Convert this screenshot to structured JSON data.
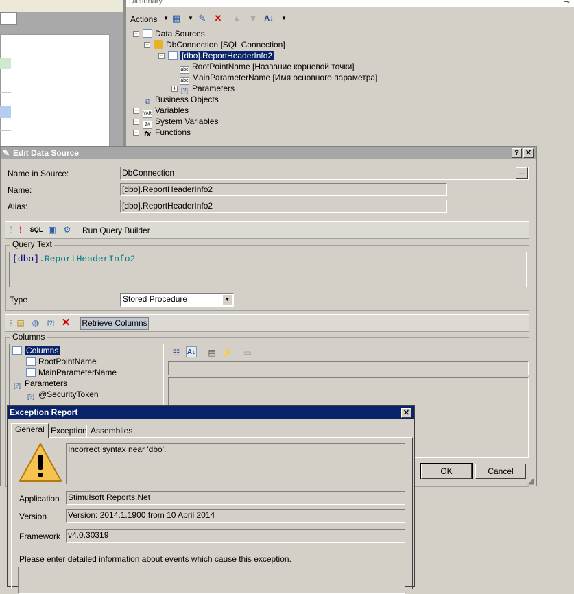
{
  "dictionary": {
    "title": "Dictionary",
    "toolbar": {
      "actions_label": "Actions"
    },
    "tree": {
      "data_sources": "Data Sources",
      "connection": "DbConnection [SQL Connection]",
      "table": "[dbo].ReportHeaderInfo2",
      "col1": "RootPointName [Название корневой точки]",
      "col2": "MainParameterName [Имя основного параметра]",
      "parameters": "Parameters",
      "business_objects": "Business Objects",
      "variables": "Variables",
      "system_variables": "System Variables",
      "functions": "Functions"
    }
  },
  "edit_data_source": {
    "title": "Edit Data Source",
    "help_btn": "?",
    "close_btn": "✕",
    "name_in_source_label": "Name in Source:",
    "name_in_source_value": "DbConnection",
    "dots": "...",
    "name_label": "Name:",
    "name_value": "[dbo].ReportHeaderInfo2",
    "alias_label": "Alias:",
    "alias_value": "[dbo].ReportHeaderInfo2",
    "sql_icon": "SQL",
    "run_query_builder": "Run Query Builder",
    "query_text_label": "Query Text",
    "query_bracket": "[dbo]",
    "query_rest": ".ReportHeaderInfo2",
    "type_label": "Type",
    "type_value": "Stored Procedure",
    "retrieve_columns": "Retrieve Columns",
    "columns_label": "Columns",
    "columns_tree": {
      "columns": "Columns",
      "col1": "RootPointName",
      "col2": "MainParameterName",
      "parameters": "Parameters",
      "param1": "@SecurityToken"
    },
    "ok": "OK",
    "cancel": "Cancel"
  },
  "exception_report": {
    "title": "Exception Report",
    "close_btn": "✕",
    "tabs": [
      "General",
      "Exception",
      "Assemblies"
    ],
    "message": "Incorrect syntax near 'dbo'.",
    "application_label": "Application",
    "application_value": "Stimulsoft Reports.Net",
    "version_label": "Version",
    "version_value": "Version: 2014.1.1900 from 10 April 2014",
    "framework_label": "Framework",
    "framework_value": "v4.0.30319",
    "info_prompt": "Please enter detailed information about events which cause this exception."
  },
  "colors": {
    "active_title": "#0a246a",
    "inactive_title": "#a6a6a6",
    "dialog_bg": "#d4d0c8",
    "query_color": "#008080",
    "error_red": "#cc0000"
  }
}
